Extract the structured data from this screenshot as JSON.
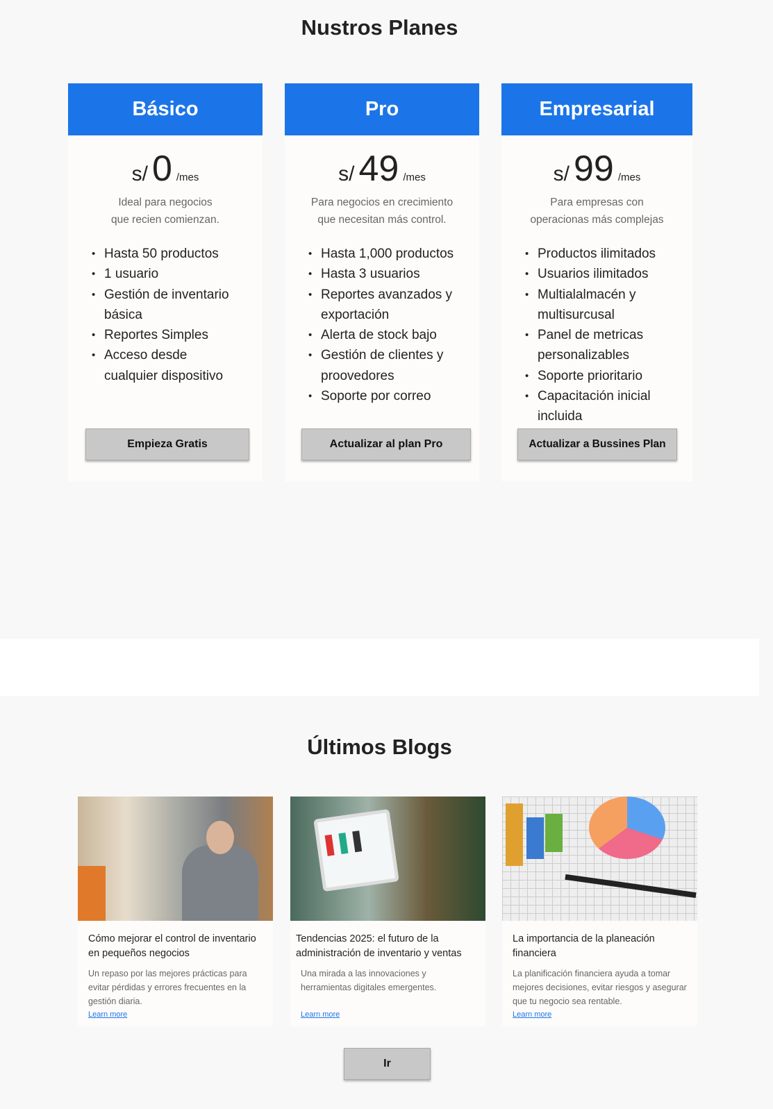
{
  "plans_section": {
    "title": "Nustros Planes"
  },
  "plans": [
    {
      "name": "Básico",
      "currency": "s/",
      "price": "0",
      "period": "/mes",
      "description": [
        "Ideal para negocios",
        "que recien comienzan."
      ],
      "features": [
        "Hasta 50 productos",
        "1 usuario",
        "Gestión de inventario básica",
        "Reportes Simples",
        "Acceso desde cualquier dispositivo"
      ],
      "button": "Empieza Gratis"
    },
    {
      "name": "Pro",
      "currency": "s/",
      "price": "49",
      "period": "/mes",
      "description": [
        "Para negocios en crecimiento",
        "que necesitan más control."
      ],
      "features": [
        "Hasta 1,000 productos",
        "Hasta 3 usuarios",
        "Reportes avanzados y exportación",
        "Alerta de stock bajo",
        "Gestión de clientes y proovedores",
        "Soporte por correo"
      ],
      "button": "Actualizar al plan Pro"
    },
    {
      "name": "Empresarial",
      "currency": "s/",
      "price": "99",
      "period": "/mes",
      "description": [
        "Para empresas con",
        "operacionas más complejas"
      ],
      "features": [
        "Productos ilimitados",
        "Usuarios ilimitados",
        "Multialalmacén y multisurcusal",
        "Panel de metricas personalizables",
        "Soporte prioritario",
        "Capacitación inicial incluida"
      ],
      "button": "Actualizar a Bussines Plan"
    }
  ],
  "blogs_section": {
    "title": "Últimos Blogs",
    "button": "Ir"
  },
  "blogs": [
    {
      "title": "Cómo mejorar el control de inventario en pequeños negocios",
      "description": "Un repaso por las mejores prácticas para evitar pérdidas y errores frecuentes en la gestión diaria.",
      "link": "Learn more"
    },
    {
      "title": "Tendencias 2025: el futuro de la administración de inventario y ventas",
      "description": "Una mirada a las innovaciones y herramientas digitales emergentes.",
      "link": "Learn more"
    },
    {
      "title": "La importancia de la planeación financiera",
      "description": "La planificación financiera ayuda a tomar mejores decisiones, evitar riesgos y asegurar que tu negocio sea rentable.",
      "link": "Learn more"
    }
  ]
}
